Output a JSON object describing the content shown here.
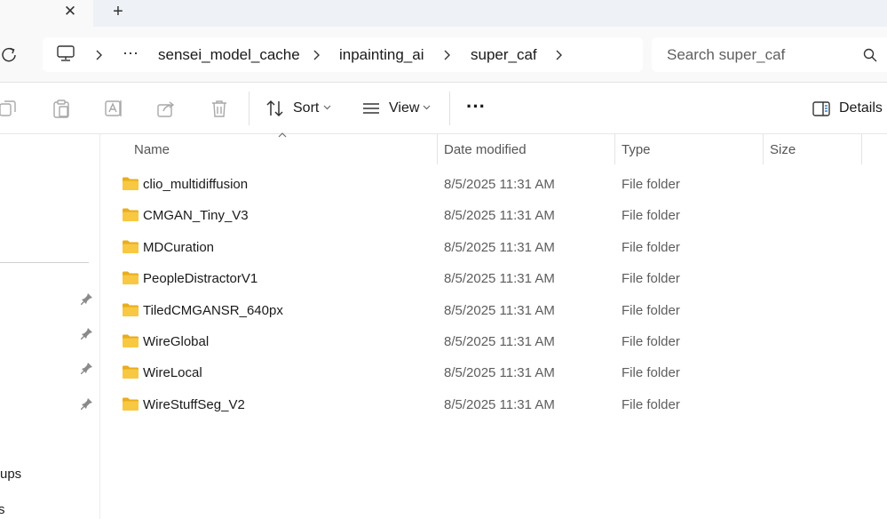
{
  "window": {
    "new_tab_label": "+",
    "close_tab_label": "✕"
  },
  "address": {
    "more_label": "···",
    "crumbs": [
      "sensei_model_cache",
      "inpainting_ai",
      "super_caf"
    ]
  },
  "search": {
    "placeholder": "Search super_caf"
  },
  "toolbar": {
    "sort_label": "Sort",
    "view_label": "View",
    "more_label": "···",
    "details_label": "Details"
  },
  "columns": {
    "name": "Name",
    "date": "Date modified",
    "type": "Type",
    "size": "Size"
  },
  "nav": {
    "partial_1": "ups",
    "partial_2": "s"
  },
  "files": [
    {
      "name": "clio_multidiffusion",
      "date": "8/5/2025 11:31 AM",
      "type": "File folder"
    },
    {
      "name": "CMGAN_Tiny_V3",
      "date": "8/5/2025 11:31 AM",
      "type": "File folder"
    },
    {
      "name": "MDCuration",
      "date": "8/5/2025 11:31 AM",
      "type": "File folder"
    },
    {
      "name": "PeopleDistractorV1",
      "date": "8/5/2025 11:31 AM",
      "type": "File folder"
    },
    {
      "name": "TiledCMGANSR_640px",
      "date": "8/5/2025 11:31 AM",
      "type": "File folder"
    },
    {
      "name": "WireGlobal",
      "date": "8/5/2025 11:31 AM",
      "type": "File folder"
    },
    {
      "name": "WireLocal",
      "date": "8/5/2025 11:31 AM",
      "type": "File folder"
    },
    {
      "name": "WireStuffSeg_V2",
      "date": "8/5/2025 11:31 AM",
      "type": "File folder"
    }
  ],
  "colors": {
    "folder_fill": "#f8c842",
    "folder_back": "#e9ad1c",
    "icon_gray": "#a8a8a8",
    "accent": "#0067c0"
  }
}
